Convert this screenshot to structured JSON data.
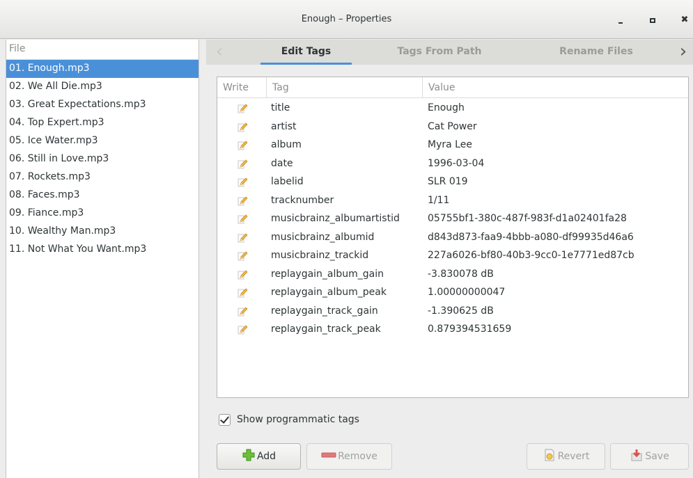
{
  "window": {
    "title": "Enough – Properties"
  },
  "files": {
    "header": "File",
    "items": [
      "01. Enough.mp3",
      "02. We All Die.mp3",
      "03. Great Expectations.mp3",
      "04. Top Expert.mp3",
      "05. Ice Water.mp3",
      "06. Still in Love.mp3",
      "07. Rockets.mp3",
      "08. Faces.mp3",
      "09. Fiance.mp3",
      "10. Wealthy Man.mp3",
      "11. Not What You Want.mp3"
    ],
    "selected_index": 0
  },
  "tabs": {
    "items": [
      "Edit Tags",
      "Tags From Path",
      "Rename Files"
    ],
    "active_index": 0
  },
  "table": {
    "columns": {
      "write": "Write",
      "tag": "Tag",
      "value": "Value"
    },
    "rows": [
      {
        "tag": "title",
        "value": "Enough"
      },
      {
        "tag": "artist",
        "value": "Cat Power"
      },
      {
        "tag": "album",
        "value": "Myra Lee"
      },
      {
        "tag": "date",
        "value": "1996-03-04"
      },
      {
        "tag": "labelid",
        "value": "SLR 019"
      },
      {
        "tag": "tracknumber",
        "value": "1/11"
      },
      {
        "tag": "musicbrainz_albumartistid",
        "value": "05755bf1-380c-487f-983f-d1a02401fa28"
      },
      {
        "tag": "musicbrainz_albumid",
        "value": "d843d873-faa9-4bbb-a080-df99935d46a6"
      },
      {
        "tag": "musicbrainz_trackid",
        "value": "227a6026-bf80-40b3-9cc0-1e7771ed87cb"
      },
      {
        "tag": "replaygain_album_gain",
        "value": "-3.830078 dB"
      },
      {
        "tag": "replaygain_album_peak",
        "value": "1.00000000047"
      },
      {
        "tag": "replaygain_track_gain",
        "value": "-1.390625 dB"
      },
      {
        "tag": "replaygain_track_peak",
        "value": "0.879394531659"
      }
    ]
  },
  "options": {
    "show_programmatic_label": "Show programmatic tags",
    "show_programmatic_checked": true
  },
  "buttons": {
    "add": "Add",
    "remove": "Remove",
    "revert": "Revert",
    "save": "Save"
  },
  "colors": {
    "selection": "#4a90d9",
    "tab_underline": "#4a90d9"
  }
}
